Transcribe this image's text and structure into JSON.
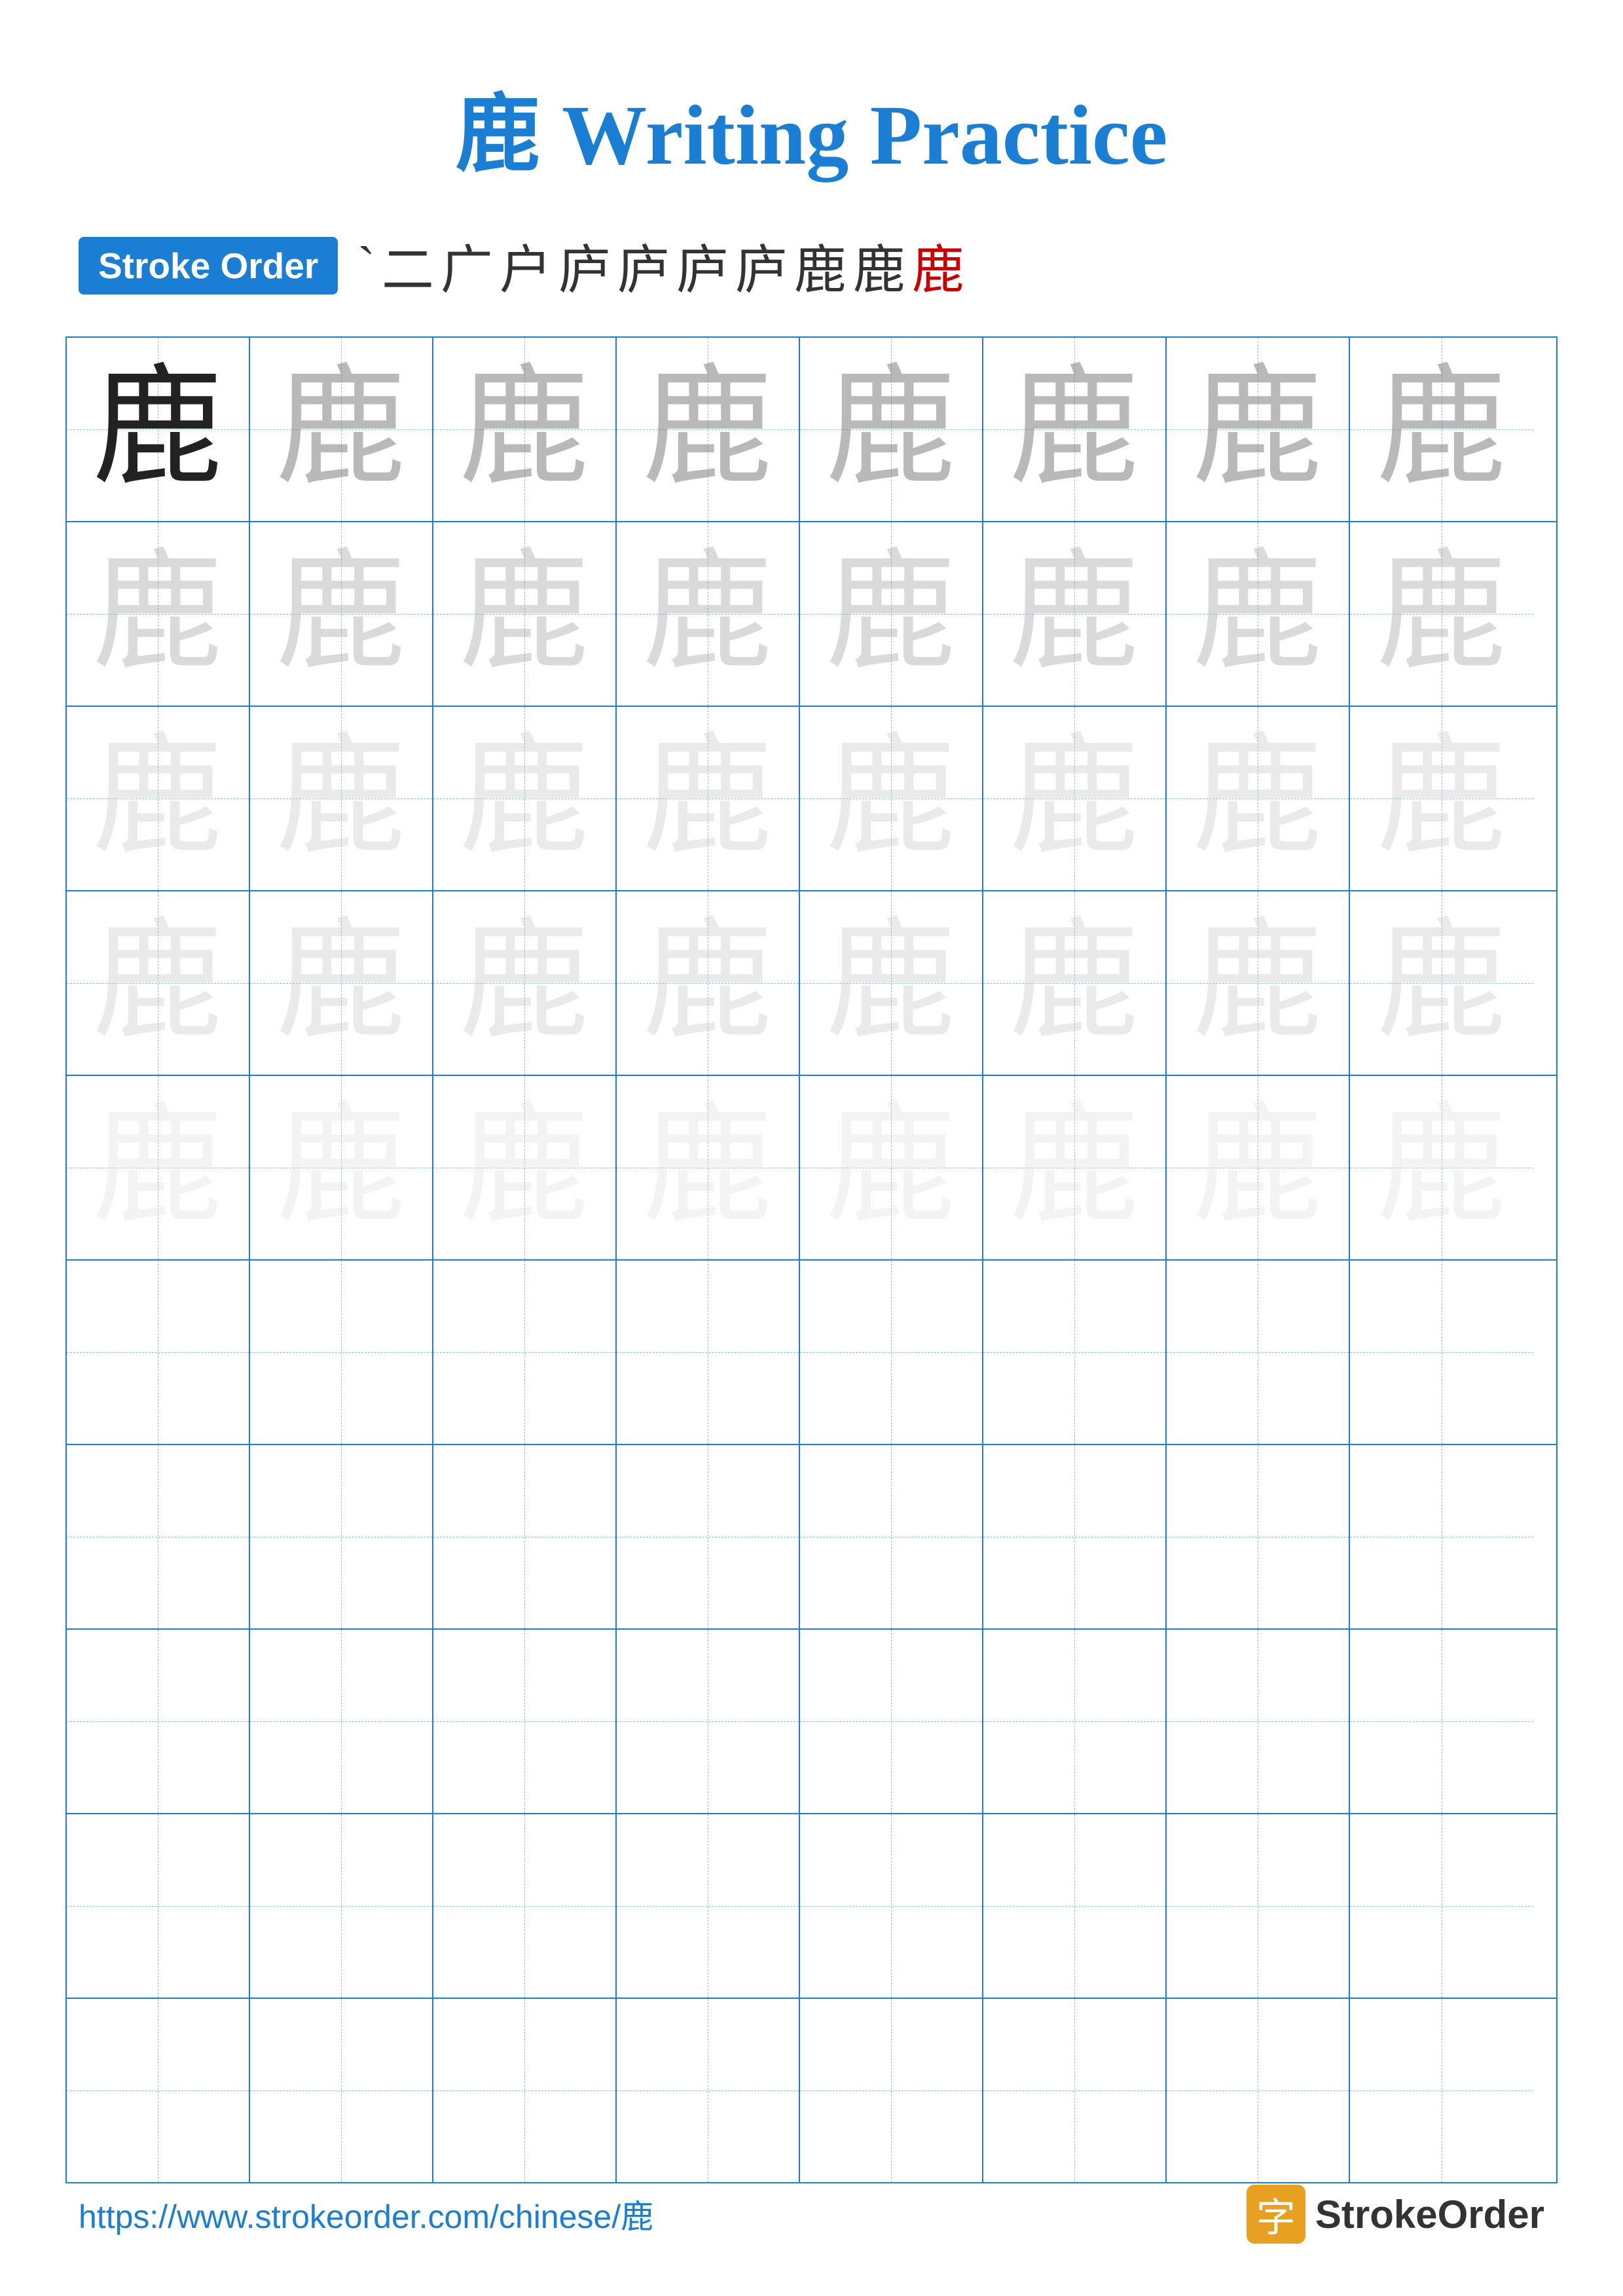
{
  "title": {
    "character": "鹿",
    "rest": " Writing Practice"
  },
  "stroke_order": {
    "badge_label": "Stroke Order",
    "strokes": [
      "`",
      "二",
      "广",
      "户",
      "庐",
      "庐",
      "庐",
      "庐",
      "鹿",
      "鹿",
      "鹿"
    ]
  },
  "grid": {
    "character": "鹿",
    "rows": 10,
    "cols": 8,
    "filled_rows": 5,
    "practice_rows": 5
  },
  "footer": {
    "url": "https://www.strokeorder.com/chinese/鹿",
    "logo_char": "字",
    "logo_text": "StrokeOrder"
  }
}
